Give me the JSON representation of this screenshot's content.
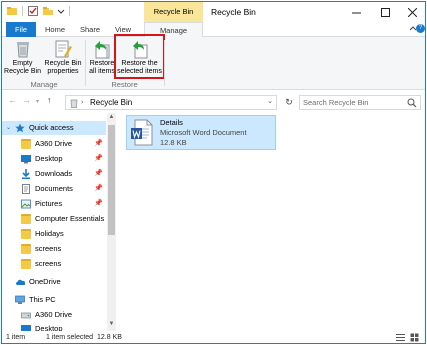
{
  "window": {
    "contextual_tab": "Recycle Bin Tools",
    "title": "Recycle Bin"
  },
  "tabs": {
    "file": "File",
    "home": "Home",
    "share": "Share",
    "view": "View",
    "manage": "Manage"
  },
  "ribbon": {
    "empty_bin": [
      "Empty",
      "Recycle Bin"
    ],
    "bin_properties": [
      "Recycle Bin",
      "properties"
    ],
    "restore_all": [
      "Restore",
      "all items"
    ],
    "restore_selected": [
      "Restore the",
      "selected items"
    ],
    "group_manage": "Manage",
    "group_restore": "Restore"
  },
  "address": {
    "crumb": "Recycle Bin",
    "search_placeholder": "Search Recycle Bin"
  },
  "nav": {
    "items": [
      {
        "label": "Quick access",
        "icon": "star-icon",
        "pinned": false,
        "selected": true
      },
      {
        "label": "A360 Drive",
        "icon": "folder-icon",
        "pinned": true
      },
      {
        "label": "Desktop",
        "icon": "desktop-icon",
        "pinned": true
      },
      {
        "label": "Downloads",
        "icon": "download-icon",
        "pinned": true
      },
      {
        "label": "Documents",
        "icon": "documents-icon",
        "pinned": true
      },
      {
        "label": "Pictures",
        "icon": "pictures-icon",
        "pinned": true
      },
      {
        "label": "Computer Essentials V",
        "icon": "folder-icon",
        "pinned": false
      },
      {
        "label": "Holidays",
        "icon": "folder-icon",
        "pinned": false
      },
      {
        "label": "screens",
        "icon": "folder-icon",
        "pinned": false
      },
      {
        "label": "screens",
        "icon": "folder-icon",
        "pinned": false
      },
      {
        "label": "OneDrive",
        "icon": "cloud-icon",
        "pinned": false
      },
      {
        "label": "This PC",
        "icon": "computer-icon",
        "pinned": false
      },
      {
        "label": "A360 Drive",
        "icon": "drive-icon",
        "pinned": false
      },
      {
        "label": "Desktop",
        "icon": "desktop-icon",
        "pinned": false
      }
    ]
  },
  "file": {
    "name": "Details",
    "type": "Microsoft Word Document",
    "size": "12.8 KB"
  },
  "status": {
    "count": "1 item",
    "selected": "1 item selected",
    "size": "12.8 KB"
  },
  "colors": {
    "accent": "#1979ca",
    "contextual": "#f9e69a",
    "highlight": "#d6141b",
    "selection": "#cce8ff"
  }
}
